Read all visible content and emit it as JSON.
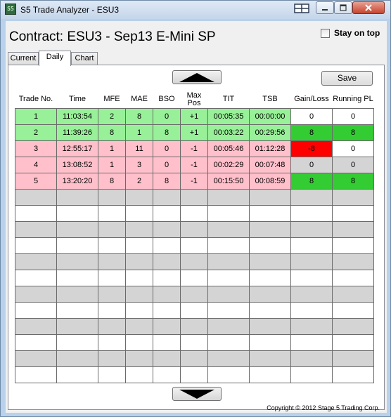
{
  "window": {
    "title": "S5 Trade Analyzer - ESU3",
    "icon_text": "S5"
  },
  "header": {
    "contract": "Contract: ESU3 - Sep13 E-Mini SP",
    "stay_on_top_label": "Stay on top",
    "stay_on_top_checked": false
  },
  "tabs": [
    {
      "label": "Current",
      "active": false
    },
    {
      "label": "Daily",
      "active": true
    },
    {
      "label": "Chart",
      "active": false
    }
  ],
  "toolbar": {
    "save_label": "Save",
    "scroll_up_icon": "triangle-up",
    "scroll_down_icon": "triangle-down"
  },
  "table": {
    "columns": [
      "Trade No.",
      "Time",
      "MFE",
      "MAE",
      "BSO",
      "Max Pos",
      "TIT",
      "TSB",
      "Gain/Loss",
      "Running PL"
    ],
    "rows": [
      {
        "result": "win",
        "cells": [
          "1",
          "11:03:54",
          "2",
          "8",
          "0",
          "+1",
          "00:05:35",
          "00:00:00",
          "0",
          "0"
        ],
        "gain_color": "white",
        "pl_color": "white"
      },
      {
        "result": "win",
        "cells": [
          "2",
          "11:39:26",
          "8",
          "1",
          "8",
          "+1",
          "00:03:22",
          "00:29:56",
          "8",
          "8"
        ],
        "gain_color": "green",
        "pl_color": "green"
      },
      {
        "result": "loss",
        "cells": [
          "3",
          "12:55:17",
          "1",
          "11",
          "0",
          "-1",
          "00:05:46",
          "01:12:28",
          "-8",
          "0"
        ],
        "gain_color": "red",
        "pl_color": "white"
      },
      {
        "result": "loss",
        "cells": [
          "4",
          "13:08:52",
          "1",
          "3",
          "0",
          "-1",
          "00:02:29",
          "00:07:48",
          "0",
          "0"
        ],
        "gain_color": "gray",
        "pl_color": "gray"
      },
      {
        "result": "loss",
        "cells": [
          "5",
          "13:20:20",
          "8",
          "2",
          "8",
          "-1",
          "00:15:50",
          "00:08:59",
          "8",
          "8"
        ],
        "gain_color": "green",
        "pl_color": "green"
      }
    ],
    "empty_row_count": 12
  },
  "colors": {
    "win_row": "#98f098",
    "loss_row": "#ffc0cb",
    "gain_green": "#33cc33",
    "loss_red": "#ff0000",
    "neutral_gray": "#d4d4d4"
  },
  "footer": {
    "copyright": "Copyright © 2012 Stage 5 Trading Corp."
  }
}
